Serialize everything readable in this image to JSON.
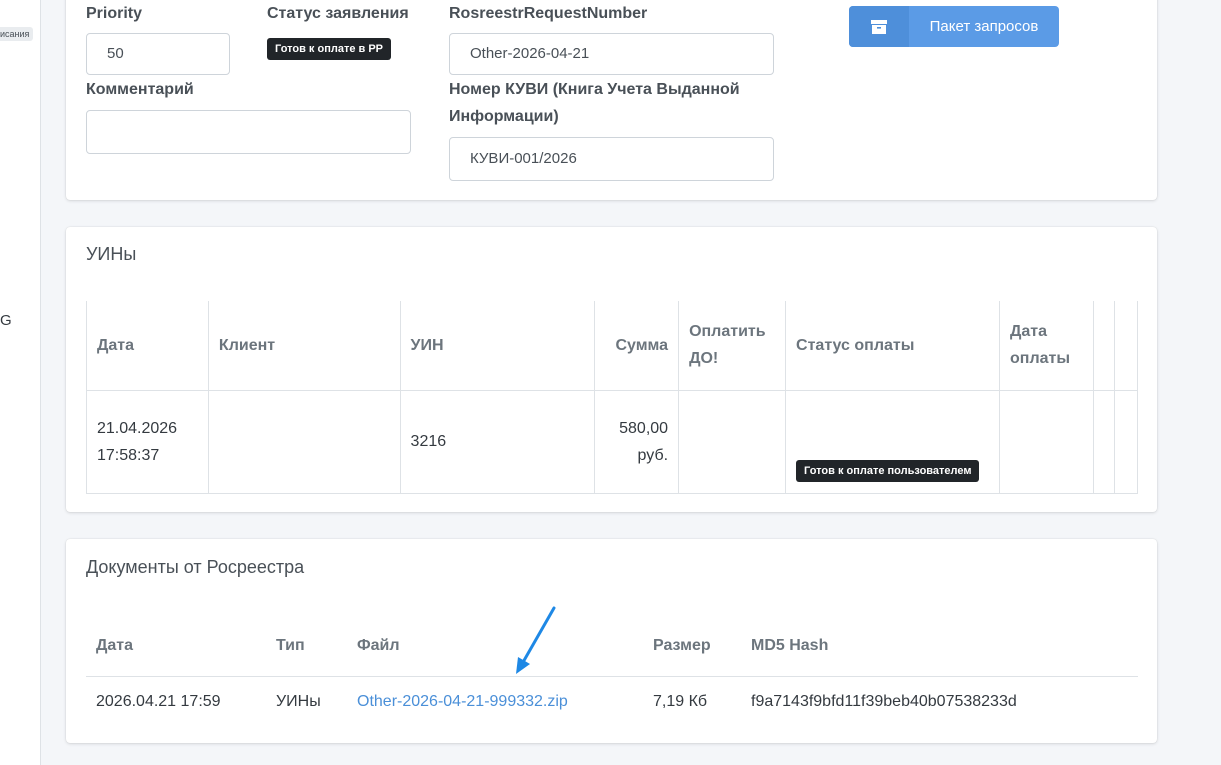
{
  "sidebar": {
    "badge": "исания",
    "letter": "G"
  },
  "form": {
    "priority_label": "Priority",
    "priority_value": "50",
    "status_label": "Статус заявления",
    "status_badge": "Готов к оплате в РР",
    "rosreestr_label": "RosreestrRequestNumber",
    "rosreestr_value": "Other-2026-04-21",
    "comment_label": "Комментарий",
    "comment_value": "",
    "kuvi_label": "Номер КУВИ (Книга Учета Выданной Информации)",
    "kuvi_value": "КУВИ-001/2026",
    "batch_button": "Пакет запросов",
    "batch_icon": "archive-icon"
  },
  "uins": {
    "title": "УИНы",
    "headers": [
      "Дата",
      "Клиент",
      "УИН",
      "Сумма",
      "Оплатить ДО!",
      "Статус оплаты",
      "Дата оплаты",
      "",
      ""
    ],
    "row": {
      "date": "21.04.2026 17:58:37",
      "client": "",
      "uin": "3216",
      "sum": "580,00 руб.",
      "pay_before": "",
      "status": "Готов к оплате пользователем",
      "paid_date": ""
    }
  },
  "docs": {
    "title": "Документы от Росреестра",
    "headers": [
      "Дата",
      "Тип",
      "Файл",
      "Размер",
      "MD5 Hash"
    ],
    "rows": [
      {
        "date": "2026.04.21 17:59",
        "type": "УИНы",
        "file": "Other-2026-04-21-999332.zip",
        "size": "7,19 Кб",
        "md5": "f9a7143f9bfd11f39beb40b07538233d"
      }
    ]
  },
  "colors": {
    "accent": "#5b9be6",
    "link": "#4a8fd8",
    "arrow": "#1e88e5",
    "badge_dark": "#212529"
  }
}
